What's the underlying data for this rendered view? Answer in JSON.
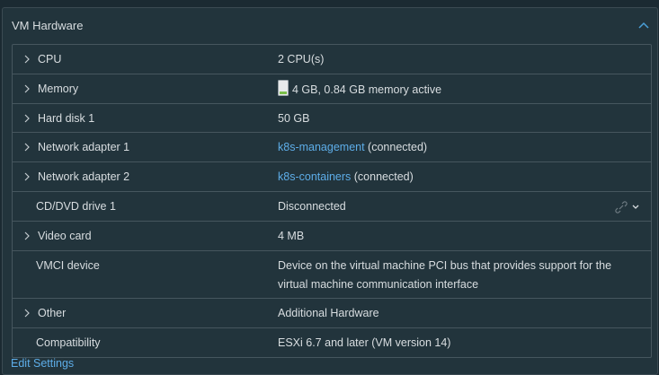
{
  "panel": {
    "title": "VM Hardware"
  },
  "rows": [
    {
      "label": "CPU",
      "value": "2 CPU(s)"
    },
    {
      "label": "Memory",
      "value": "4 GB, 0.84 GB memory active"
    },
    {
      "label": "Hard disk 1",
      "value": "50 GB"
    },
    {
      "label": "Network adapter 1",
      "link": "k8s-management",
      "suffix": " (connected)"
    },
    {
      "label": "Network adapter 2",
      "link": "k8s-containers",
      "suffix": " (connected)"
    },
    {
      "label": "CD/DVD drive 1",
      "value": "Disconnected"
    },
    {
      "label": "Video card",
      "value": "4 MB"
    },
    {
      "label": "VMCI device",
      "value": "Device on the virtual machine PCI bus that provides support for the virtual machine communication interface"
    },
    {
      "label": "Other",
      "value": "Additional Hardware"
    },
    {
      "label": "Compatibility",
      "value": "ESXi 6.7 and later (VM version 14)"
    }
  ],
  "footer": {
    "edit_label": "Edit Settings"
  },
  "icons": {
    "collapse": "chevron-up-icon",
    "expand": "chevron-right-icon",
    "memory": "memory-meter-icon",
    "cd_connect": "link-icon",
    "cd_menu": "chevron-down-icon"
  },
  "colors": {
    "background": "#1b2a32",
    "panel": "#22343c",
    "border": "#46565e",
    "link": "#5dade8",
    "text": "#d8dde0",
    "accent": "#4aa0d8"
  }
}
